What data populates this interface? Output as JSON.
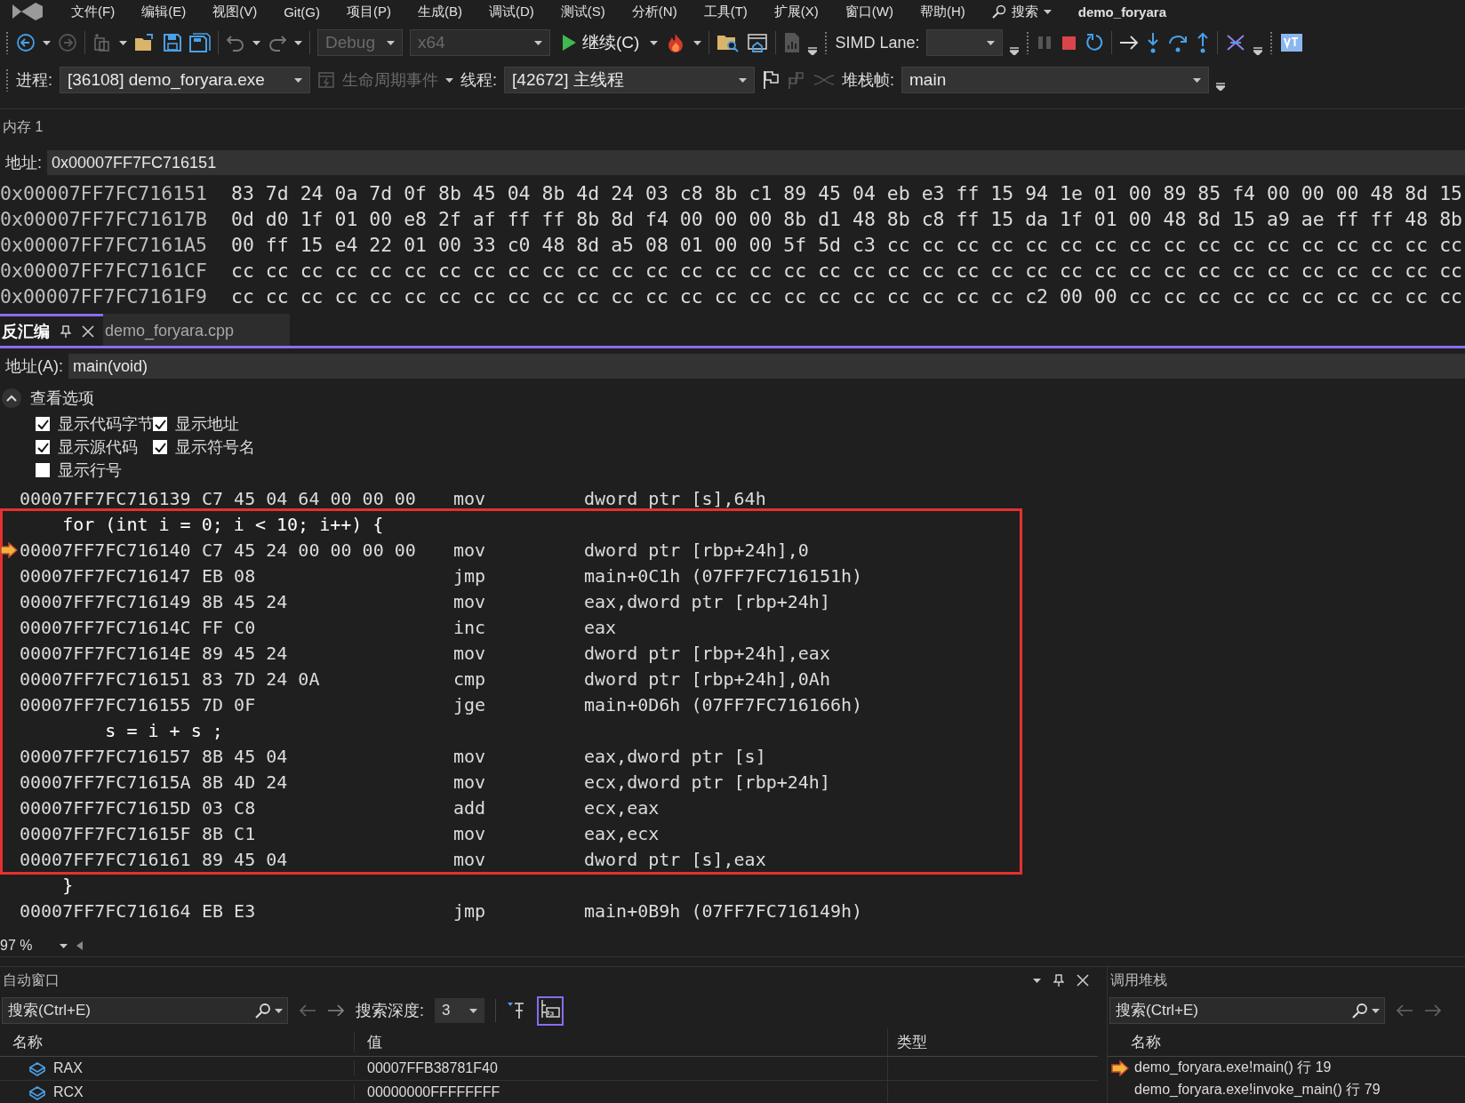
{
  "menu": {
    "items": [
      "文件(F)",
      "编辑(E)",
      "视图(V)",
      "Git(G)",
      "项目(P)",
      "生成(B)",
      "调试(D)",
      "测试(S)",
      "分析(N)",
      "工具(T)",
      "扩展(X)",
      "窗口(W)",
      "帮助(H)"
    ],
    "search": "搜索",
    "solution": "demo_foryara"
  },
  "toolbar": {
    "config": {
      "value": "Debug",
      "disabled": true
    },
    "platform": {
      "value": "x64",
      "disabled": true
    },
    "continue": "继续(C)",
    "simd_label": "SIMD Lane:"
  },
  "debug_location": {
    "process_label": "进程:",
    "process": "[36108] demo_foryara.exe",
    "lifecycle": {
      "label": "生命周期事件",
      "disabled": true
    },
    "thread_label": "线程:",
    "thread": "[42672] 主线程",
    "frame_label": "堆栈帧:",
    "frame": "main"
  },
  "memory": {
    "title": "内存 1",
    "address_label": "地址:",
    "address": "0x00007FF7FC716151",
    "rows": [
      {
        "address": "0x00007FF7FC716151",
        "bytes": "83 7d 24 0a 7d 0f 8b 45 04 8b 4d 24 03 c8 8b c1 89 45 04 eb e3 ff 15 94 1e 01 00 89 85 f4 00 00 00 48 8d 15"
      },
      {
        "address": "0x00007FF7FC71617B",
        "bytes": "0d d0 1f 01 00 e8 2f af ff ff 8b 8d f4 00 00 00 8b d1 48 8b c8 ff 15 da 1f 01 00 48 8d 15 a9 ae ff ff 48 8b"
      },
      {
        "address": "0x00007FF7FC7161A5",
        "bytes": "00 ff 15 e4 22 01 00 33 c0 48 8d a5 08 01 00 00 5f 5d c3 cc cc cc cc cc cc cc cc cc cc cc cc cc cc cc cc cc"
      },
      {
        "address": "0x00007FF7FC7161CF",
        "bytes": "cc cc cc cc cc cc cc cc cc cc cc cc cc cc cc cc cc cc cc cc cc cc cc cc cc cc cc cc cc cc cc cc cc cc cc cc"
      },
      {
        "address": "0x00007FF7FC7161F9",
        "bytes": "cc cc cc cc cc cc cc cc cc cc cc cc cc cc cc cc cc cc cc cc cc cc cc c2 00 00 cc cc cc cc cc cc cc cc cc cc"
      }
    ]
  },
  "tabs": [
    {
      "label": "反汇编",
      "selected": true
    },
    {
      "label": "demo_foryara.cpp",
      "selected": false
    }
  ],
  "disassembly": {
    "address_label": "地址(A):",
    "address": "main(void)",
    "view_options": {
      "title": "查看选项",
      "expanded": true,
      "items": [
        {
          "label": "显示代码字节",
          "checked": true
        },
        {
          "label": "显示地址",
          "checked": true
        },
        {
          "label": "显示源代码",
          "checked": true
        },
        {
          "label": "显示符号名",
          "checked": true
        },
        {
          "label": "显示行号",
          "checked": false
        }
      ]
    },
    "lines_before": [
      {
        "kind": "asm",
        "address": "00007FF7FC716139",
        "bytes": "C7 45 04 64 00 00 00",
        "mnemonic": "mov",
        "operands": "dword ptr [s],64h",
        "current": false
      }
    ],
    "highlight_box": {
      "lines": [
        {
          "kind": "source",
          "text": "    for (int i = 0; i < 10; i++) {"
        },
        {
          "kind": "asm",
          "address": "00007FF7FC716140",
          "bytes": "C7 45 24 00 00 00 00",
          "mnemonic": "mov",
          "operands": "dword ptr [rbp+24h],0",
          "current": true
        },
        {
          "kind": "asm",
          "address": "00007FF7FC716147",
          "bytes": "EB 08",
          "mnemonic": "jmp",
          "operands": "main+0C1h (07FF7FC716151h)",
          "current": false
        },
        {
          "kind": "asm",
          "address": "00007FF7FC716149",
          "bytes": "8B 45 24",
          "mnemonic": "mov",
          "operands": "eax,dword ptr [rbp+24h]",
          "current": false
        },
        {
          "kind": "asm",
          "address": "00007FF7FC71614C",
          "bytes": "FF C0",
          "mnemonic": "inc",
          "operands": "eax",
          "current": false
        },
        {
          "kind": "asm",
          "address": "00007FF7FC71614E",
          "bytes": "89 45 24",
          "mnemonic": "mov",
          "operands": "dword ptr [rbp+24h],eax",
          "current": false
        },
        {
          "kind": "asm",
          "address": "00007FF7FC716151",
          "bytes": "83 7D 24 0A",
          "mnemonic": "cmp",
          "operands": "dword ptr [rbp+24h],0Ah",
          "current": false
        },
        {
          "kind": "asm",
          "address": "00007FF7FC716155",
          "bytes": "7D 0F",
          "mnemonic": "jge",
          "operands": "main+0D6h (07FF7FC716166h)",
          "current": false
        },
        {
          "kind": "source",
          "text": "        s = i + s ;"
        },
        {
          "kind": "asm",
          "address": "00007FF7FC716157",
          "bytes": "8B 45 04",
          "mnemonic": "mov",
          "operands": "eax,dword ptr [s]",
          "current": false
        },
        {
          "kind": "asm",
          "address": "00007FF7FC71615A",
          "bytes": "8B 4D 24",
          "mnemonic": "mov",
          "operands": "ecx,dword ptr [rbp+24h]",
          "current": false
        },
        {
          "kind": "asm",
          "address": "00007FF7FC71615D",
          "bytes": "03 C8",
          "mnemonic": "add",
          "operands": "ecx,eax",
          "current": false
        },
        {
          "kind": "asm",
          "address": "00007FF7FC71615F",
          "bytes": "8B C1",
          "mnemonic": "mov",
          "operands": "eax,ecx",
          "current": false
        },
        {
          "kind": "asm",
          "address": "00007FF7FC716161",
          "bytes": "89 45 04",
          "mnemonic": "mov",
          "operands": "dword ptr [s],eax",
          "current": false
        }
      ]
    },
    "lines_after": [
      {
        "kind": "source",
        "text": "    }"
      },
      {
        "kind": "asm",
        "address": "00007FF7FC716164",
        "bytes": "EB E3",
        "mnemonic": "jmp",
        "operands": "main+0B9h (07FF7FC716149h)",
        "current": false
      }
    ],
    "zoom": "97 %"
  },
  "autos": {
    "title": "自动窗口",
    "search_placeholder": "搜索(Ctrl+E)",
    "depth_label": "搜索深度:",
    "depth": "3",
    "columns": [
      "名称",
      "值",
      "类型"
    ],
    "rows": [
      {
        "name": "RAX",
        "value": "00007FFB38781F40"
      },
      {
        "name": "RCX",
        "value": "00000000FFFFFFFF"
      }
    ]
  },
  "call_stack": {
    "title": "调用堆栈",
    "search_placeholder": "搜索(Ctrl+E)",
    "columns": [
      "名称"
    ],
    "rows": [
      {
        "name": "demo_foryara.exe!main() 行 19",
        "current": true
      },
      {
        "name": "demo_foryara.exe!invoke_main() 行 79",
        "current": false
      }
    ]
  }
}
